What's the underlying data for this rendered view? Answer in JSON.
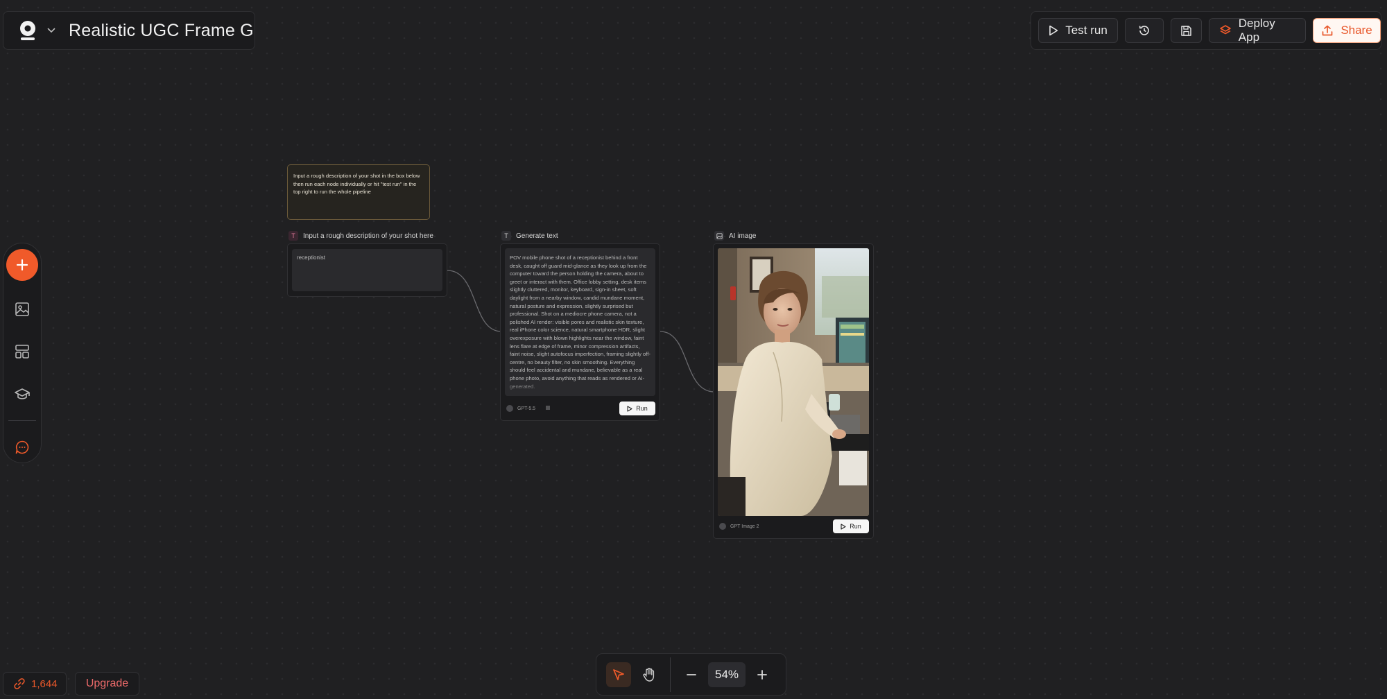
{
  "app": {
    "title": "Realistic UGC Frame G"
  },
  "toolbar": {
    "test_run_label": "Test run",
    "deploy_label": "Deploy App",
    "share_label": "Share",
    "accent_color": "#f05a2a"
  },
  "canvas": {
    "note_text": "Input a rough description of your shot in the box below then run each node individually or hit \"test run\" in the top right to run the whole pipeline",
    "nodes": [
      {
        "label": "Input a rough description of your shot here",
        "type_icon": "T",
        "value": "receptionist"
      },
      {
        "label": "Generate text",
        "type_icon": "T",
        "output": "POV mobile phone shot of a receptionist behind a front desk, caught off guard mid-glance as they look up from the computer toward the person holding the camera, about to greet or interact with them. Office lobby setting, desk items slightly cluttered, monitor, keyboard, sign-in sheet, soft daylight from a nearby window, candid mundane moment, natural posture and expression, slightly surprised but professional. Shot on a mediocre phone camera, not a polished AI render: visible pores and realistic skin texture, real iPhone color science, natural smartphone HDR, slight overexposure with blown highlights near the window, faint lens flare at edge of frame, minor compression artifacts, faint noise, slight autofocus imperfection, framing slightly off-centre, no beauty filter, no skin smoothing. Everything should feel accidental and mundane, believable as a real phone photo, avoid anything that reads as rendered or AI-generated.",
        "model": "GPT-5.5",
        "run_label": "Run"
      },
      {
        "label": "AI image",
        "type_icon": "image",
        "model": "GPT Image 2",
        "run_label": "Run"
      }
    ]
  },
  "bottom": {
    "credits": "1,644",
    "upgrade_label": "Upgrade",
    "zoom": "54%"
  }
}
